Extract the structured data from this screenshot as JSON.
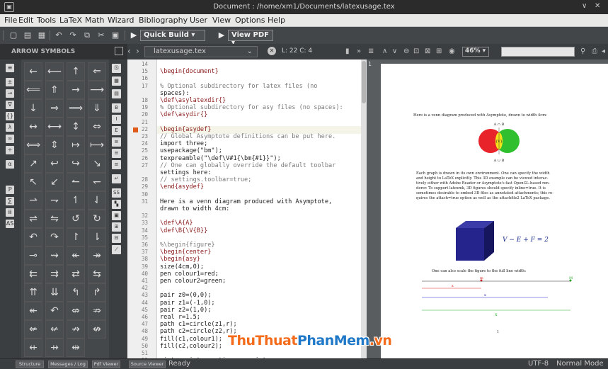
{
  "window": {
    "title": "Document : /home/xm1/Documents/latexusage.tex",
    "icon": "app-icon"
  },
  "menu": [
    "File",
    "Edit",
    "Tools",
    "LaTeX",
    "Math",
    "Wizard",
    "Bibliography",
    "User",
    "View",
    "Options",
    "Help"
  ],
  "toolbar": {
    "quick_build": "Quick Build",
    "view_pdf": "View PDF"
  },
  "symbols": {
    "header": "ARROW SYMBOLS",
    "grid": [
      "←",
      "⟵",
      "↑",
      "⇐",
      "⟸",
      "⇑",
      "→",
      "⟶",
      "↓",
      "⇒",
      "⟹",
      "⇓",
      "↔",
      "⟷",
      "↕",
      "⇔",
      "⟺",
      "⇕",
      "↦",
      "⟼",
      "↗",
      "↩",
      "↪",
      "↘",
      "↖",
      "↙",
      "↼",
      "↽",
      "⇀",
      "⇁",
      "↿",
      "⇃",
      "⇌",
      "⇋",
      "↺",
      "↻",
      "↶",
      "↷",
      "↾",
      "⇂",
      "⊸",
      "⇝",
      "↞",
      "↠",
      "⇇",
      "⇉",
      "⇄",
      "⇆",
      "⇈",
      "⇊",
      "↰",
      "↱",
      "↞",
      "↶",
      "⇎",
      "⇏",
      "⇍",
      "↚",
      "↛",
      "↮",
      "⇷",
      "⇸",
      "⇹"
    ]
  },
  "editor": {
    "filename": "latexusage.tex",
    "position": "L: 22 C: 4",
    "lines": [
      {
        "n": "14",
        "t": ""
      },
      {
        "n": "15",
        "t": "\\begin{document}"
      },
      {
        "n": "16",
        "t": ""
      },
      {
        "n": "17",
        "t": "% Optional subdirectory for latex files (no"
      },
      {
        "n": "",
        "t": "spaces):"
      },
      {
        "n": "18",
        "t": "\\def\\asylatexdir{}"
      },
      {
        "n": "19",
        "t": "% Optional subdirectory for asy files (no spaces):"
      },
      {
        "n": "20",
        "t": "\\def\\asydir{}"
      },
      {
        "n": "21",
        "t": ""
      },
      {
        "n": "22",
        "t": "\\begin{asydef}"
      },
      {
        "n": "23",
        "t": "// Global Asymptote definitions can be put here."
      },
      {
        "n": "24",
        "t": "import three;"
      },
      {
        "n": "25",
        "t": "usepackage(\"bm\");"
      },
      {
        "n": "26",
        "t": "texpreamble(\"\\def\\V#1{\\bm{#1}}\");"
      },
      {
        "n": "27",
        "t": "// One can globally override the default toolbar"
      },
      {
        "n": "",
        "t": "settings here:"
      },
      {
        "n": "28",
        "t": "// settings.toolbar=true;"
      },
      {
        "n": "29",
        "t": "\\end{asydef}"
      },
      {
        "n": "30",
        "t": ""
      },
      {
        "n": "31",
        "t": "Here is a venn diagram produced with Asymptote,"
      },
      {
        "n": "",
        "t": "drawn to width 4cm:"
      },
      {
        "n": "32",
        "t": ""
      },
      {
        "n": "33",
        "t": "\\def\\A{A}"
      },
      {
        "n": "34",
        "t": "\\def\\B{\\V{B}}"
      },
      {
        "n": "35",
        "t": ""
      },
      {
        "n": "36",
        "t": "%\\begin{figure}"
      },
      {
        "n": "37",
        "t": "\\begin{center}"
      },
      {
        "n": "38",
        "t": "\\begin{asy}"
      },
      {
        "n": "39",
        "t": "size(4cm,0);"
      },
      {
        "n": "40",
        "t": "pen colour1=red;"
      },
      {
        "n": "41",
        "t": "pen colour2=green;"
      },
      {
        "n": "42",
        "t": ""
      },
      {
        "n": "43",
        "t": "pair z0=(0,0);"
      },
      {
        "n": "44",
        "t": "pair z1=(-1,0);"
      },
      {
        "n": "45",
        "t": "pair z2=(1,0);"
      },
      {
        "n": "46",
        "t": "real r=1.5;"
      },
      {
        "n": "47",
        "t": "path c1=circle(z1,r);"
      },
      {
        "n": "48",
        "t": "path c2=circle(z2,r);"
      },
      {
        "n": "49",
        "t": "fill(c1,colour1);"
      },
      {
        "n": "50",
        "t": "fill(c2,colour2);"
      },
      {
        "n": "51",
        "t": ""
      },
      {
        "n": "52",
        "t": "picture intersection=new picture;"
      }
    ]
  },
  "pdf": {
    "zoom": "46%",
    "page_number": "1",
    "intro": "Here is a venn diagram produced with Asymptote, drawn to width 4cm:",
    "venn_top": "A ∩ B",
    "venn_mid": "{V}",
    "venn_bottom": "A ∪ B",
    "para": [
      "Each graph is drawn in its own environment. One can specify the width",
      "and height to LaTeX explicitly. This 3D example can be viewed interac-",
      "tively either with Adobe Reader or Asymptote's fast OpenGL-based ren-",
      "derer. To support latexmk, 3D figures should specify inline=true. It is",
      "sometimes desirable to embed 3D files as annotated attachments; this re-",
      "quires the attach=true option as well as the attachfile2 LaTeX package."
    ],
    "euler": "V − E + F = 2",
    "scale_text": "One can also scale the figure to the full line width:",
    "line_labels": {
      "m": "m",
      "M": "M",
      "x1": "x",
      "x2": "x",
      "x3": "X"
    }
  },
  "statusbar": {
    "buttons": [
      "Structure",
      "Messages / Log",
      "Pdf Viewer",
      "Source Viewer"
    ],
    "ready": "Ready",
    "encoding": "UTF-8",
    "mode": "Normal Mode"
  },
  "watermark": {
    "part1": "ThuThuat",
    "part2": "PhanMem",
    "part3": ".vn"
  },
  "colors": {
    "accent_orange": "#e05a1a",
    "venn_red": "#e8232a",
    "venn_green": "#2fbf2f",
    "cube": "#24248c"
  }
}
